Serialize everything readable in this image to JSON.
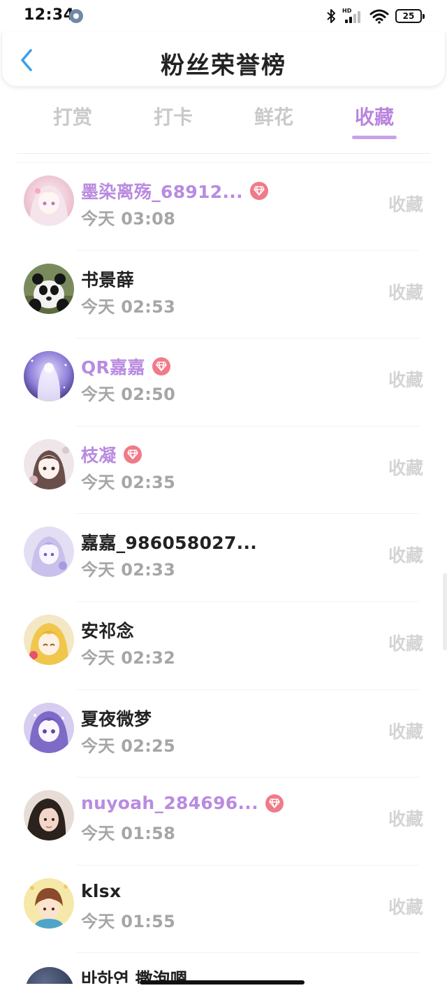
{
  "status_bar": {
    "time": "12:34",
    "hd_label": "HD",
    "battery": "25"
  },
  "header": {
    "title": "粉丝荣誉榜"
  },
  "tabs": [
    {
      "label": "打赏",
      "active": false
    },
    {
      "label": "打卡",
      "active": false
    },
    {
      "label": "鲜花",
      "active": false
    },
    {
      "label": "收藏",
      "active": true
    }
  ],
  "colors": {
    "accent": "#b985df",
    "vip_name": "#b98be0",
    "vip_badge": "#f07b88",
    "muted": "#a6a6a6",
    "inactive_tab": "#c9c9c9"
  },
  "list": [
    {
      "name": "墨染离殇_68912...",
      "vip": true,
      "time": "今天 03:08",
      "action": "收藏",
      "avatar": "anime-girl-avatar"
    },
    {
      "name": "书景薛",
      "vip": false,
      "time": "今天 02:53",
      "action": "收藏",
      "avatar": "panda-avatar"
    },
    {
      "name": "QR嘉嘉",
      "vip": true,
      "time": "今天 02:50",
      "action": "收藏",
      "avatar": "ethereal-girl-avatar"
    },
    {
      "name": "枝凝",
      "vip": true,
      "time": "今天 02:35",
      "action": "收藏",
      "avatar": "sketch-girl-avatar"
    },
    {
      "name": "嘉嘉_986058027...",
      "vip": false,
      "time": "今天 02:33",
      "action": "收藏",
      "avatar": "lavender-girl-avatar"
    },
    {
      "name": "安祁念",
      "vip": false,
      "time": "今天 02:32",
      "action": "收藏",
      "avatar": "blonde-anime-avatar"
    },
    {
      "name": "夏夜微梦",
      "vip": false,
      "time": "今天 02:25",
      "action": "收藏",
      "avatar": "purple-anime-avatar"
    },
    {
      "name": "nuyoah_284696...",
      "vip": true,
      "time": "今天 01:58",
      "action": "收藏",
      "avatar": "photo-girl-avatar"
    },
    {
      "name": "klsx",
      "vip": false,
      "time": "今天 01:55",
      "action": "收藏",
      "avatar": "cartoon-boy-avatar"
    }
  ],
  "partial_row": {
    "name": "바하연  撒泡嗯"
  }
}
